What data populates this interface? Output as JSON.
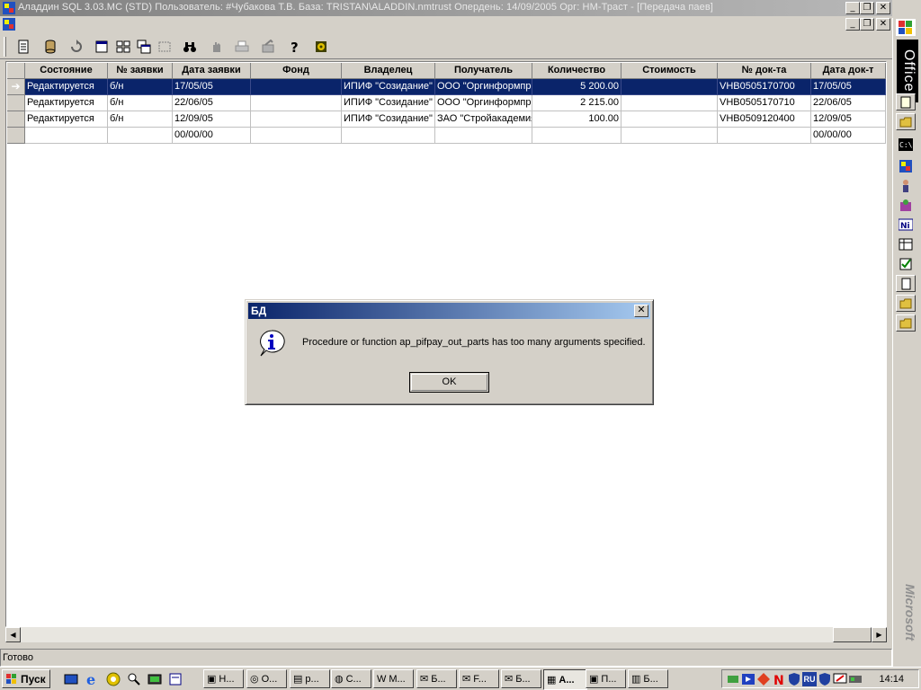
{
  "window": {
    "title": "Аладдин SQL 3.03.MC (STD)  Пользователь: #Чубакова Т.В. База: TRISTAN\\ALADDIN.nmtrust Опердень: 14/09/2005 Орг: НМ-Траст - [Передача паев]",
    "caption_min": "_",
    "caption_max": "❐",
    "caption_close": "✕"
  },
  "grid": {
    "columns": [
      "Состояние",
      "№ заявки",
      "Дата заявки",
      "Фонд",
      "Владелец",
      "Получатель",
      "Количество",
      "Стоимость",
      "№ док-та",
      "Дата док-т"
    ],
    "rows": [
      {
        "state": "Редактируется",
        "req_no": "б/н",
        "req_date": "17/05/05",
        "fund": "",
        "owner": "ИПИФ \"Созидание\"",
        "recipient": "ООО \"Оргинформпро",
        "quantity": "5 200.00",
        "cost": "",
        "doc_no": "VHB0505170700",
        "doc_date": "17/05/05",
        "selected": true,
        "indicator": "➔"
      },
      {
        "state": "Редактируется",
        "req_no": "б/н",
        "req_date": "22/06/05",
        "fund": "",
        "owner": "ИПИФ \"Созидание\"",
        "recipient": "ООО \"Оргинформпро",
        "quantity": "2 215.00",
        "cost": "",
        "doc_no": "VHB0505170710",
        "doc_date": "22/06/05",
        "selected": false,
        "indicator": ""
      },
      {
        "state": "Редактируется",
        "req_no": "б/н",
        "req_date": "12/09/05",
        "fund": "",
        "owner": "ИПИФ \"Созидание\"",
        "recipient": "ЗАО \"Стройакадемия",
        "quantity": "100.00",
        "cost": "",
        "doc_no": "VHB0509120400",
        "doc_date": "12/09/05",
        "selected": false,
        "indicator": ""
      },
      {
        "state": "",
        "req_no": "",
        "req_date": "00/00/00",
        "fund": "",
        "owner": "",
        "recipient": "",
        "quantity": "",
        "cost": "",
        "doc_no": "",
        "doc_date": "00/00/00",
        "selected": false,
        "indicator": ""
      }
    ]
  },
  "status": {
    "text": "Готово"
  },
  "office_bar": {
    "label": "Office",
    "brand": "Microsoft"
  },
  "dialog": {
    "title": "БД",
    "message": "Procedure or function ap_pifpay_out_parts has too many arguments specified.",
    "ok_label": "OK",
    "close": "✕"
  },
  "taskbar": {
    "start_label": "Пуск",
    "tasks": [
      "Н...",
      "О...",
      "р...",
      "С...",
      "М...",
      "Б...",
      "F...",
      "Б...",
      "А...",
      "П...",
      "Б..."
    ],
    "active_task_index": 8,
    "clock": "14:14",
    "lang": "RU"
  },
  "colors": {
    "selection": "#0a246a",
    "titlebar_active": "#0a246a",
    "titlebar_inactive": "#808080"
  }
}
